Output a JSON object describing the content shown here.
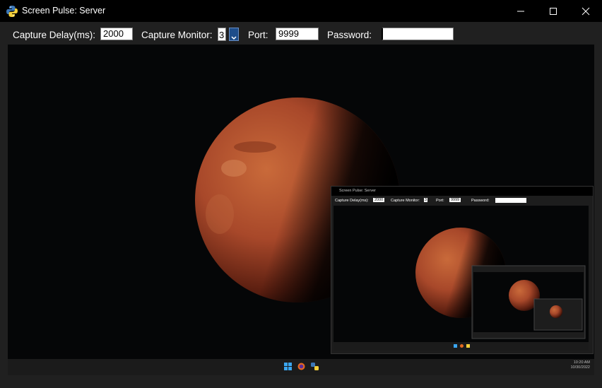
{
  "window": {
    "title": "Screen Pulse: Server",
    "minimize_icon": "minimize-icon",
    "maximize_icon": "maximize-icon",
    "close_icon": "close-icon",
    "app_icon": "python-icon"
  },
  "controls": {
    "capture_delay_label": "Capture Delay(ms):",
    "capture_delay_value": "2000",
    "capture_monitor_label": "Capture Monitor:",
    "capture_monitor_value": "3",
    "port_label": "Port:",
    "port_value": "9999",
    "password_label": "Password:",
    "password_value": ""
  },
  "preview": {
    "taskbar_icons": [
      "windows-start-icon",
      "firefox-icon",
      "python-icon"
    ],
    "clock_time": "10:20 AM",
    "clock_date": "10/30/2022",
    "nested": {
      "title": "Screen Pulse: Server",
      "capture_delay_label": "Capture Delay(ms):",
      "capture_delay_value": "2000",
      "capture_monitor_label": "Capture Monitor:",
      "capture_monitor_value": "3",
      "port_label": "Port:",
      "port_value": "9999",
      "password_label": "Password:"
    }
  },
  "colors": {
    "titlebar": "#000000",
    "window_bg": "#202020",
    "spin_accent": "#1e4d8a",
    "mars": "#b0502a"
  }
}
